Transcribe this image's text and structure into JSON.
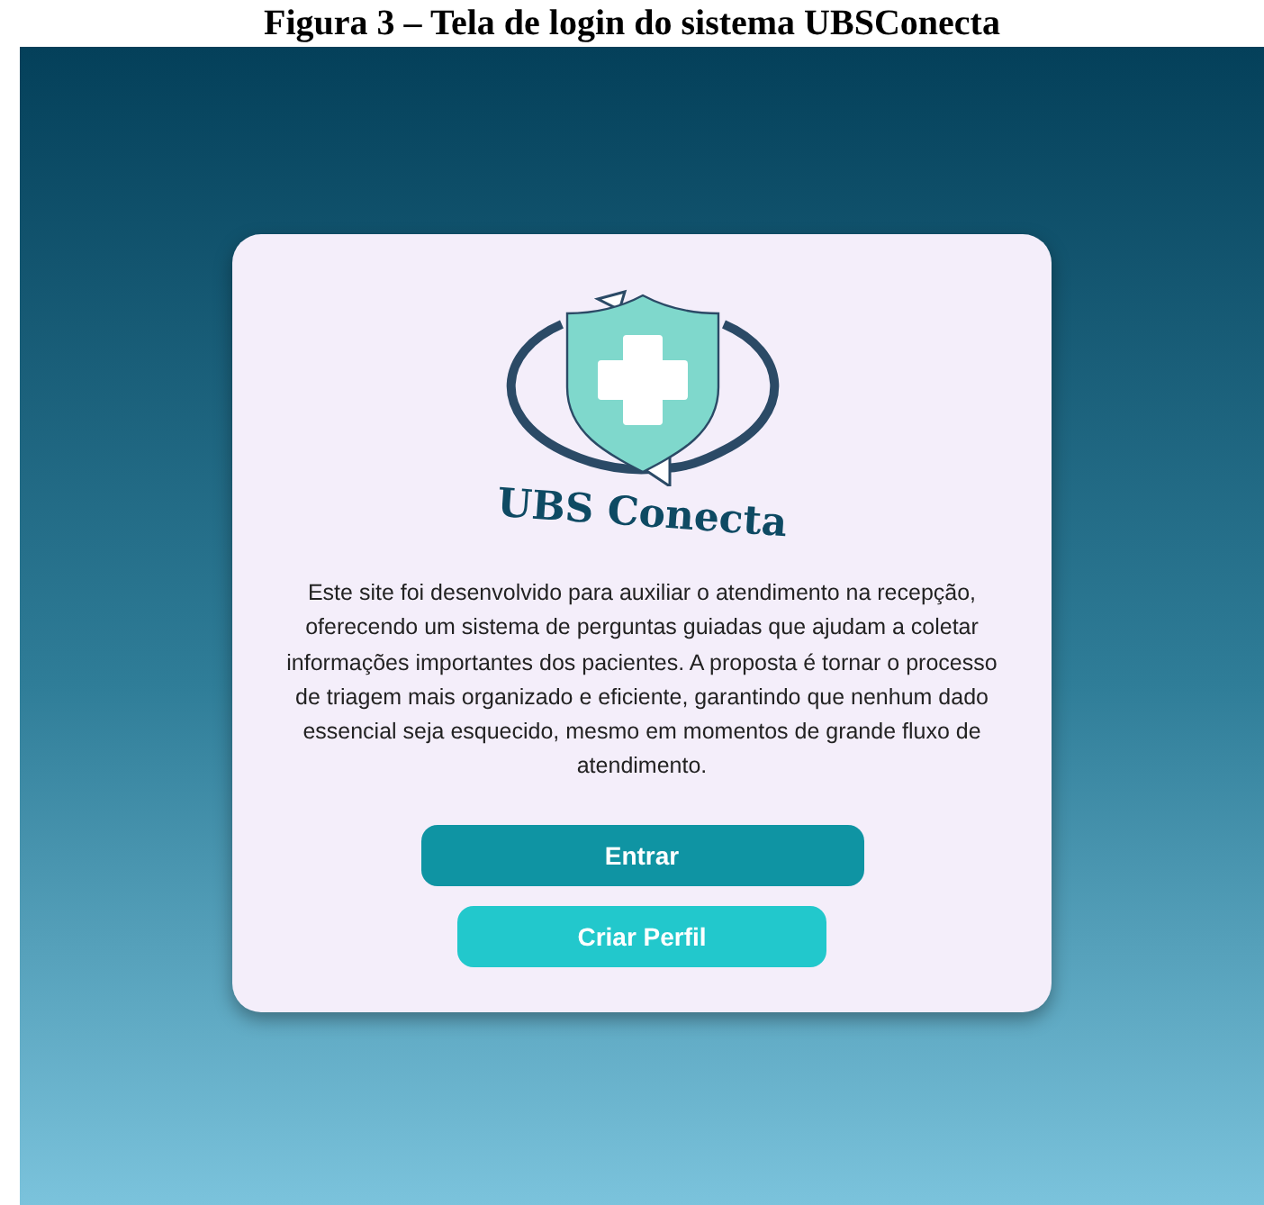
{
  "caption": "Figura 3 – Tela de login do sistema UBSConecta",
  "logo": {
    "text": "UBS Conecta"
  },
  "description": "Este site foi desenvolvido para auxiliar o atendimento na recepção, oferecendo um sistema de perguntas guiadas que ajudam a coletar informações importantes dos pacientes. A proposta é tornar o processo de triagem mais organizado e eficiente, garantindo que nenhum dado essencial seja esquecido, mesmo em momentos de grande fluxo de atendimento.",
  "buttons": [
    {
      "label": "Entrar",
      "kind": "primary"
    },
    {
      "label": "Criar Perfil",
      "kind": "secondary"
    }
  ]
}
